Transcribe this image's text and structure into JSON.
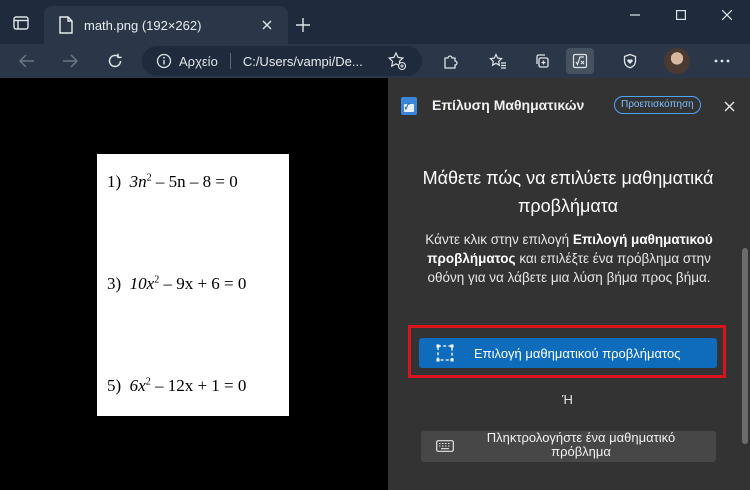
{
  "tab": {
    "title": "math.png (192×262)"
  },
  "address": {
    "scheme_label": "Αρχείο",
    "url": "C:/Users/vampi/De..."
  },
  "math_image": {
    "equations": [
      {
        "num": "1)",
        "pre": "3n",
        "exp": "2",
        "post": " – 5n – 8 = 0"
      },
      {
        "num": "3)",
        "pre": "10x",
        "exp": "2",
        "post": " – 9x + 6 = 0"
      },
      {
        "num": "5)",
        "pre": "6x",
        "exp": "2",
        "post": " – 12x + 1 = 0"
      }
    ]
  },
  "panel": {
    "title": "Επίλυση Μαθηματικών",
    "badge": "Προεπισκόπηση",
    "heading": "Μάθετε πώς να επιλύετε μαθηματικά προβλήματα",
    "desc_1": "Κάντε κλικ στην επιλογή ",
    "desc_bold": "Επιλογή μαθηματικού προβλήματος",
    "desc_2": " και επιλέξτε ένα πρόβλημα στην οθόνη για να λάβετε μια λύση βήμα προς βήμα.",
    "select_button": "Επιλογή μαθηματικού προβλήματος",
    "or": "Ή",
    "type_button": "Πληκτρολογήστε ένα μαθηματικό πρόβλημα"
  },
  "colors": {
    "accent": "#0f6cbd",
    "highlight": "#d9141c",
    "panel_bg": "#333333"
  }
}
